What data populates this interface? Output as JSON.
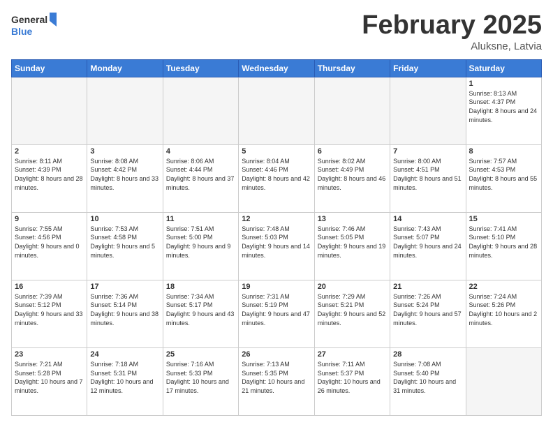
{
  "header": {
    "logo_general": "General",
    "logo_blue": "Blue",
    "month_title": "February 2025",
    "subtitle": "Aluksne, Latvia"
  },
  "calendar": {
    "days_of_week": [
      "Sunday",
      "Monday",
      "Tuesday",
      "Wednesday",
      "Thursday",
      "Friday",
      "Saturday"
    ],
    "weeks": [
      [
        {
          "day": "",
          "empty": true
        },
        {
          "day": "",
          "empty": true
        },
        {
          "day": "",
          "empty": true
        },
        {
          "day": "",
          "empty": true
        },
        {
          "day": "",
          "empty": true
        },
        {
          "day": "",
          "empty": true
        },
        {
          "day": "1",
          "sunrise": "8:13 AM",
          "sunset": "4:37 PM",
          "daylight": "8 hours and 24 minutes."
        }
      ],
      [
        {
          "day": "2",
          "sunrise": "8:11 AM",
          "sunset": "4:39 PM",
          "daylight": "8 hours and 28 minutes."
        },
        {
          "day": "3",
          "sunrise": "8:08 AM",
          "sunset": "4:42 PM",
          "daylight": "8 hours and 33 minutes."
        },
        {
          "day": "4",
          "sunrise": "8:06 AM",
          "sunset": "4:44 PM",
          "daylight": "8 hours and 37 minutes."
        },
        {
          "day": "5",
          "sunrise": "8:04 AM",
          "sunset": "4:46 PM",
          "daylight": "8 hours and 42 minutes."
        },
        {
          "day": "6",
          "sunrise": "8:02 AM",
          "sunset": "4:49 PM",
          "daylight": "8 hours and 46 minutes."
        },
        {
          "day": "7",
          "sunrise": "8:00 AM",
          "sunset": "4:51 PM",
          "daylight": "8 hours and 51 minutes."
        },
        {
          "day": "8",
          "sunrise": "7:57 AM",
          "sunset": "4:53 PM",
          "daylight": "8 hours and 55 minutes."
        }
      ],
      [
        {
          "day": "9",
          "sunrise": "7:55 AM",
          "sunset": "4:56 PM",
          "daylight": "9 hours and 0 minutes."
        },
        {
          "day": "10",
          "sunrise": "7:53 AM",
          "sunset": "4:58 PM",
          "daylight": "9 hours and 5 minutes."
        },
        {
          "day": "11",
          "sunrise": "7:51 AM",
          "sunset": "5:00 PM",
          "daylight": "9 hours and 9 minutes."
        },
        {
          "day": "12",
          "sunrise": "7:48 AM",
          "sunset": "5:03 PM",
          "daylight": "9 hours and 14 minutes."
        },
        {
          "day": "13",
          "sunrise": "7:46 AM",
          "sunset": "5:05 PM",
          "daylight": "9 hours and 19 minutes."
        },
        {
          "day": "14",
          "sunrise": "7:43 AM",
          "sunset": "5:07 PM",
          "daylight": "9 hours and 24 minutes."
        },
        {
          "day": "15",
          "sunrise": "7:41 AM",
          "sunset": "5:10 PM",
          "daylight": "9 hours and 28 minutes."
        }
      ],
      [
        {
          "day": "16",
          "sunrise": "7:39 AM",
          "sunset": "5:12 PM",
          "daylight": "9 hours and 33 minutes."
        },
        {
          "day": "17",
          "sunrise": "7:36 AM",
          "sunset": "5:14 PM",
          "daylight": "9 hours and 38 minutes."
        },
        {
          "day": "18",
          "sunrise": "7:34 AM",
          "sunset": "5:17 PM",
          "daylight": "9 hours and 43 minutes."
        },
        {
          "day": "19",
          "sunrise": "7:31 AM",
          "sunset": "5:19 PM",
          "daylight": "9 hours and 47 minutes."
        },
        {
          "day": "20",
          "sunrise": "7:29 AM",
          "sunset": "5:21 PM",
          "daylight": "9 hours and 52 minutes."
        },
        {
          "day": "21",
          "sunrise": "7:26 AM",
          "sunset": "5:24 PM",
          "daylight": "9 hours and 57 minutes."
        },
        {
          "day": "22",
          "sunrise": "7:24 AM",
          "sunset": "5:26 PM",
          "daylight": "10 hours and 2 minutes."
        }
      ],
      [
        {
          "day": "23",
          "sunrise": "7:21 AM",
          "sunset": "5:28 PM",
          "daylight": "10 hours and 7 minutes."
        },
        {
          "day": "24",
          "sunrise": "7:18 AM",
          "sunset": "5:31 PM",
          "daylight": "10 hours and 12 minutes."
        },
        {
          "day": "25",
          "sunrise": "7:16 AM",
          "sunset": "5:33 PM",
          "daylight": "10 hours and 17 minutes."
        },
        {
          "day": "26",
          "sunrise": "7:13 AM",
          "sunset": "5:35 PM",
          "daylight": "10 hours and 21 minutes."
        },
        {
          "day": "27",
          "sunrise": "7:11 AM",
          "sunset": "5:37 PM",
          "daylight": "10 hours and 26 minutes."
        },
        {
          "day": "28",
          "sunrise": "7:08 AM",
          "sunset": "5:40 PM",
          "daylight": "10 hours and 31 minutes."
        },
        {
          "day": "",
          "empty": true
        }
      ]
    ]
  }
}
